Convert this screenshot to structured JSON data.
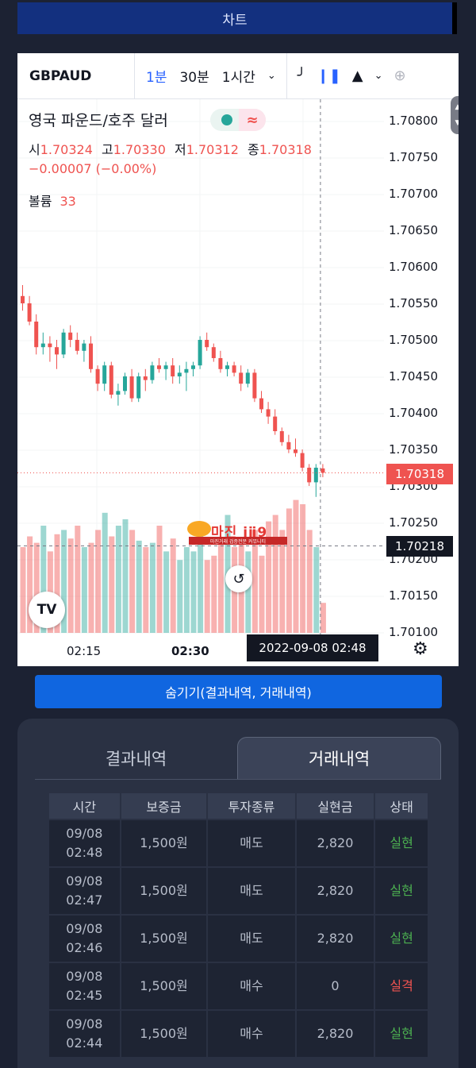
{
  "header": {
    "chart_button": "차트"
  },
  "chart_toolbar": {
    "symbol": "GBPAUD",
    "timeframes": [
      "1분",
      "30분",
      "1시간"
    ],
    "active_timeframe": "1분"
  },
  "legend": {
    "title": "영국 파운드/호주 달러",
    "open_label": "시",
    "open": "1.70324",
    "high_label": "고",
    "high": "1.70330",
    "low_label": "저",
    "low": "1.70312",
    "close_label": "종",
    "close": "1.70318",
    "change": "−0.00007 (−0.00%)",
    "volume_label": "볼륨",
    "volume": "33"
  },
  "price_axis": [
    "1.70800",
    "1.70750",
    "1.70700",
    "1.70650",
    "1.70600",
    "1.70550",
    "1.70500",
    "1.70450",
    "1.70400",
    "1.70350",
    "1.70300",
    "1.70250",
    "1.70200",
    "1.70150",
    "1.70100"
  ],
  "price_badges": {
    "last": "1.70318",
    "crosshair": "1.70218"
  },
  "time_axis": {
    "t1": "02:15",
    "t2": "02:30",
    "crosshair": "2022-09-08   02:48"
  },
  "watermark": {
    "brand": "마진",
    "tagline": "마진거래 검증전문 커뮤니티"
  },
  "colors": {
    "up": "#26a69a",
    "down": "#ef5350",
    "accent": "#2962ff",
    "status_ok": "#4caf50",
    "status_fail": "#ef5350"
  },
  "chart_data": {
    "type": "candlestick",
    "symbol": "GBPAUD",
    "interval": "1분",
    "ylim": [
      1.701,
      1.708
    ],
    "candles": [
      {
        "o": 1.7056,
        "h": 1.70575,
        "l": 1.7054,
        "c": 1.7055
      },
      {
        "o": 1.7055,
        "h": 1.7056,
        "l": 1.7052,
        "c": 1.70525
      },
      {
        "o": 1.70525,
        "h": 1.70535,
        "l": 1.7048,
        "c": 1.7049
      },
      {
        "o": 1.7049,
        "h": 1.7051,
        "l": 1.7048,
        "c": 1.70495
      },
      {
        "o": 1.70495,
        "h": 1.70505,
        "l": 1.7047,
        "c": 1.7049
      },
      {
        "o": 1.7049,
        "h": 1.705,
        "l": 1.7046,
        "c": 1.7048
      },
      {
        "o": 1.7048,
        "h": 1.70515,
        "l": 1.70475,
        "c": 1.7051
      },
      {
        "o": 1.7051,
        "h": 1.7052,
        "l": 1.7049,
        "c": 1.705
      },
      {
        "o": 1.705,
        "h": 1.7051,
        "l": 1.7048,
        "c": 1.70485
      },
      {
        "o": 1.70485,
        "h": 1.705,
        "l": 1.7047,
        "c": 1.70495
      },
      {
        "o": 1.70495,
        "h": 1.70505,
        "l": 1.70455,
        "c": 1.7046
      },
      {
        "o": 1.7046,
        "h": 1.70465,
        "l": 1.7043,
        "c": 1.7044
      },
      {
        "o": 1.7044,
        "h": 1.7047,
        "l": 1.7043,
        "c": 1.70465
      },
      {
        "o": 1.70465,
        "h": 1.7047,
        "l": 1.7042,
        "c": 1.70425
      },
      {
        "o": 1.70425,
        "h": 1.7044,
        "l": 1.7041,
        "c": 1.7043
      },
      {
        "o": 1.7043,
        "h": 1.70455,
        "l": 1.70425,
        "c": 1.7045
      },
      {
        "o": 1.7045,
        "h": 1.7046,
        "l": 1.70415,
        "c": 1.7042
      },
      {
        "o": 1.7042,
        "h": 1.70455,
        "l": 1.70415,
        "c": 1.7045
      },
      {
        "o": 1.7045,
        "h": 1.7046,
        "l": 1.7043,
        "c": 1.70445
      },
      {
        "o": 1.70445,
        "h": 1.7047,
        "l": 1.7044,
        "c": 1.70465
      },
      {
        "o": 1.70465,
        "h": 1.70475,
        "l": 1.70455,
        "c": 1.7046
      },
      {
        "o": 1.7046,
        "h": 1.7047,
        "l": 1.70445,
        "c": 1.70465
      },
      {
        "o": 1.70465,
        "h": 1.70475,
        "l": 1.7044,
        "c": 1.7045
      },
      {
        "o": 1.7045,
        "h": 1.70465,
        "l": 1.7044,
        "c": 1.70455
      },
      {
        "o": 1.70455,
        "h": 1.7047,
        "l": 1.7043,
        "c": 1.7046
      },
      {
        "o": 1.7046,
        "h": 1.7047,
        "l": 1.7045,
        "c": 1.70465
      },
      {
        "o": 1.70465,
        "h": 1.70505,
        "l": 1.7046,
        "c": 1.705
      },
      {
        "o": 1.705,
        "h": 1.7051,
        "l": 1.70485,
        "c": 1.7049
      },
      {
        "o": 1.7049,
        "h": 1.70495,
        "l": 1.7047,
        "c": 1.70475
      },
      {
        "o": 1.70475,
        "h": 1.70485,
        "l": 1.70455,
        "c": 1.7046
      },
      {
        "o": 1.7046,
        "h": 1.7047,
        "l": 1.7045,
        "c": 1.70465
      },
      {
        "o": 1.70465,
        "h": 1.7047,
        "l": 1.7045,
        "c": 1.70455
      },
      {
        "o": 1.70455,
        "h": 1.70465,
        "l": 1.7043,
        "c": 1.7044
      },
      {
        "o": 1.7044,
        "h": 1.7046,
        "l": 1.70435,
        "c": 1.70455
      },
      {
        "o": 1.70455,
        "h": 1.7046,
        "l": 1.70415,
        "c": 1.7042
      },
      {
        "o": 1.7042,
        "h": 1.7043,
        "l": 1.704,
        "c": 1.70405
      },
      {
        "o": 1.70405,
        "h": 1.70415,
        "l": 1.70385,
        "c": 1.70395
      },
      {
        "o": 1.70395,
        "h": 1.70405,
        "l": 1.7037,
        "c": 1.70375
      },
      {
        "o": 1.70375,
        "h": 1.7038,
        "l": 1.70355,
        "c": 1.7036
      },
      {
        "o": 1.7036,
        "h": 1.7037,
        "l": 1.70345,
        "c": 1.7035
      },
      {
        "o": 1.7035,
        "h": 1.70365,
        "l": 1.7034,
        "c": 1.70345
      },
      {
        "o": 1.70345,
        "h": 1.7035,
        "l": 1.7032,
        "c": 1.70325
      },
      {
        "o": 1.70325,
        "h": 1.7033,
        "l": 1.703,
        "c": 1.70305
      },
      {
        "o": 1.70305,
        "h": 1.7033,
        "l": 1.70285,
        "c": 1.70325
      },
      {
        "o": 1.70324,
        "h": 1.7033,
        "l": 1.70312,
        "c": 1.70318
      }
    ],
    "volumes": [
      40,
      45,
      42,
      50,
      38,
      46,
      48,
      44,
      50,
      40,
      42,
      48,
      56,
      45,
      50,
      53,
      48,
      43,
      40,
      42,
      50,
      38,
      44,
      34,
      40,
      38,
      45,
      34,
      36,
      42,
      55,
      40,
      43,
      38,
      48,
      36,
      52,
      55,
      48,
      58,
      62,
      60,
      48,
      40,
      14
    ]
  },
  "bottom_panel": {
    "hide_button": "숨기기(결과내역, 거래내역)",
    "tabs": [
      "결과내역",
      "거래내역"
    ],
    "active_tab": "거래내역",
    "columns": [
      "시간",
      "보증금",
      "투자종류",
      "실현금",
      "상태"
    ],
    "rows": [
      {
        "date": "09/08",
        "time": "02:48",
        "deposit": "1,500원",
        "type": "매도",
        "realized": "2,820",
        "status": "실현"
      },
      {
        "date": "09/08",
        "time": "02:47",
        "deposit": "1,500원",
        "type": "매도",
        "realized": "2,820",
        "status": "실현"
      },
      {
        "date": "09/08",
        "time": "02:46",
        "deposit": "1,500원",
        "type": "매도",
        "realized": "2,820",
        "status": "실현"
      },
      {
        "date": "09/08",
        "time": "02:45",
        "deposit": "1,500원",
        "type": "매수",
        "realized": "0",
        "status": "실격"
      },
      {
        "date": "09/08",
        "time": "02:44",
        "deposit": "1,500원",
        "type": "매수",
        "realized": "2,820",
        "status": "실현"
      }
    ]
  }
}
